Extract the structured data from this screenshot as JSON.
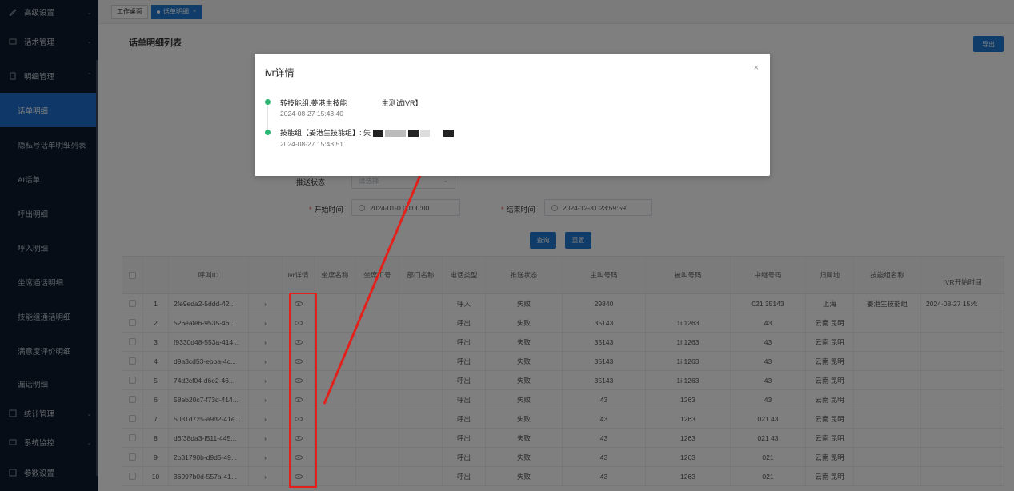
{
  "sidebar": {
    "items": [
      {
        "label": "高级设置",
        "icon": "pen-icon",
        "expanded": false
      },
      {
        "label": "话术管理",
        "icon": "chat-icon",
        "expanded": false
      },
      {
        "label": "明细管理",
        "icon": "document-icon",
        "expanded": true
      }
    ],
    "sub_items": [
      "话单明细",
      "隐私号话单明细列表",
      "AI话单",
      "呼出明细",
      "呼入明细",
      "坐席通话明细",
      "技能组通话明细",
      "满意度评价明细",
      "漏话明细"
    ],
    "bottom_items": [
      {
        "label": "统计管理",
        "icon": "chart-icon"
      },
      {
        "label": "系统监控",
        "icon": "monitor-icon"
      },
      {
        "label": "参数设置",
        "icon": "settings-icon"
      }
    ]
  },
  "tabs": [
    "工作桌面",
    "话单明细"
  ],
  "page": {
    "title": "话单明细列表",
    "export_label": "导出"
  },
  "form": {
    "push_status_label": "推送状态",
    "push_status_placeholder": "请选择",
    "start_time_label": "开始时间",
    "start_time_value": "2024-01-0 00:00:00",
    "end_time_label": "结束时间",
    "end_time_value": "2024-12-31 23:59:59",
    "query_label": "查询",
    "reset_label": "重置"
  },
  "table": {
    "headers": [
      "呼叫ID",
      "ivr详情",
      "坐席名称",
      "坐席工号",
      "部门名称",
      "电话类型",
      "推送状态",
      "主叫号码",
      "被叫号码",
      "中继号码",
      "归属地",
      "技能组名称",
      "IVR开始时间"
    ],
    "rows": [
      {
        "no": "1",
        "id": "2fe9eda2-5ddd-42...",
        "type": "呼入",
        "status": "失败",
        "caller": "29840",
        "callee": "",
        "trunk": "021 35143",
        "location": "上海",
        "skill": "姜港生技能组",
        "ivr_start": "2024-08-27 15:4:"
      },
      {
        "no": "2",
        "id": "526eafe6-9535-46...",
        "type": "呼出",
        "status": "失败",
        "caller": "35143",
        "callee": "1i 1263",
        "trunk": "43",
        "location": "云南 昆明",
        "skill": "",
        "ivr_start": ""
      },
      {
        "no": "3",
        "id": "f9330d48-553a-414...",
        "type": "呼出",
        "status": "失败",
        "caller": "35143",
        "callee": "1i 1263",
        "trunk": "43",
        "location": "云南 昆明",
        "skill": "",
        "ivr_start": ""
      },
      {
        "no": "4",
        "id": "d9a3cd53-ebba-4c...",
        "type": "呼出",
        "status": "失败",
        "caller": "35143",
        "callee": "1i 1263",
        "trunk": "43",
        "location": "云南 昆明",
        "skill": "",
        "ivr_start": ""
      },
      {
        "no": "5",
        "id": "74d2cf04-d6e2-46...",
        "type": "呼出",
        "status": "失败",
        "caller": "35143",
        "callee": "1i 1263",
        "trunk": "43",
        "location": "云南 昆明",
        "skill": "",
        "ivr_start": ""
      },
      {
        "no": "6",
        "id": "58eb20c7-f73d-414...",
        "type": "呼出",
        "status": "失败",
        "caller": "43",
        "callee": "1263",
        "trunk": "43",
        "location": "云南 昆明",
        "skill": "",
        "ivr_start": ""
      },
      {
        "no": "7",
        "id": "5031d725-a9d2-41e...",
        "type": "呼出",
        "status": "失败",
        "caller": "43",
        "callee": "1263",
        "trunk": "021 43",
        "location": "云南 昆明",
        "skill": "",
        "ivr_start": ""
      },
      {
        "no": "8",
        "id": "d6f38da3-f511-445...",
        "type": "呼出",
        "status": "失败",
        "caller": "43",
        "callee": "1263",
        "trunk": "021 43",
        "location": "云南 昆明",
        "skill": "",
        "ivr_start": ""
      },
      {
        "no": "9",
        "id": "2b31790b-d9d5-49...",
        "type": "呼出",
        "status": "失败",
        "caller": "43",
        "callee": "1263",
        "trunk": "021",
        "location": "云南 昆明",
        "skill": "",
        "ivr_start": ""
      },
      {
        "no": "10",
        "id": "36997b0d-557a-41...",
        "type": "呼出",
        "status": "失败",
        "caller": "43",
        "callee": "1263",
        "trunk": "021",
        "location": "云南 昆明",
        "skill": "",
        "ivr_start": ""
      }
    ]
  },
  "modal": {
    "title": "ivr详情",
    "close": "×",
    "events": [
      {
        "text": "转技能组:姜港生技能",
        "suffix": "生测试IVR】",
        "time": "2024-08-27 15:43:40"
      },
      {
        "text": "技能组【姜港生技能组】: 失",
        "suffix": "",
        "time": "2024-08-27 15:43:51"
      }
    ]
  },
  "colors": {
    "accent": "#1f78d1",
    "sidebar_bg": "#0f1b2d",
    "timeline_dot": "#2bb673",
    "annotation_red": "#e2211c"
  }
}
